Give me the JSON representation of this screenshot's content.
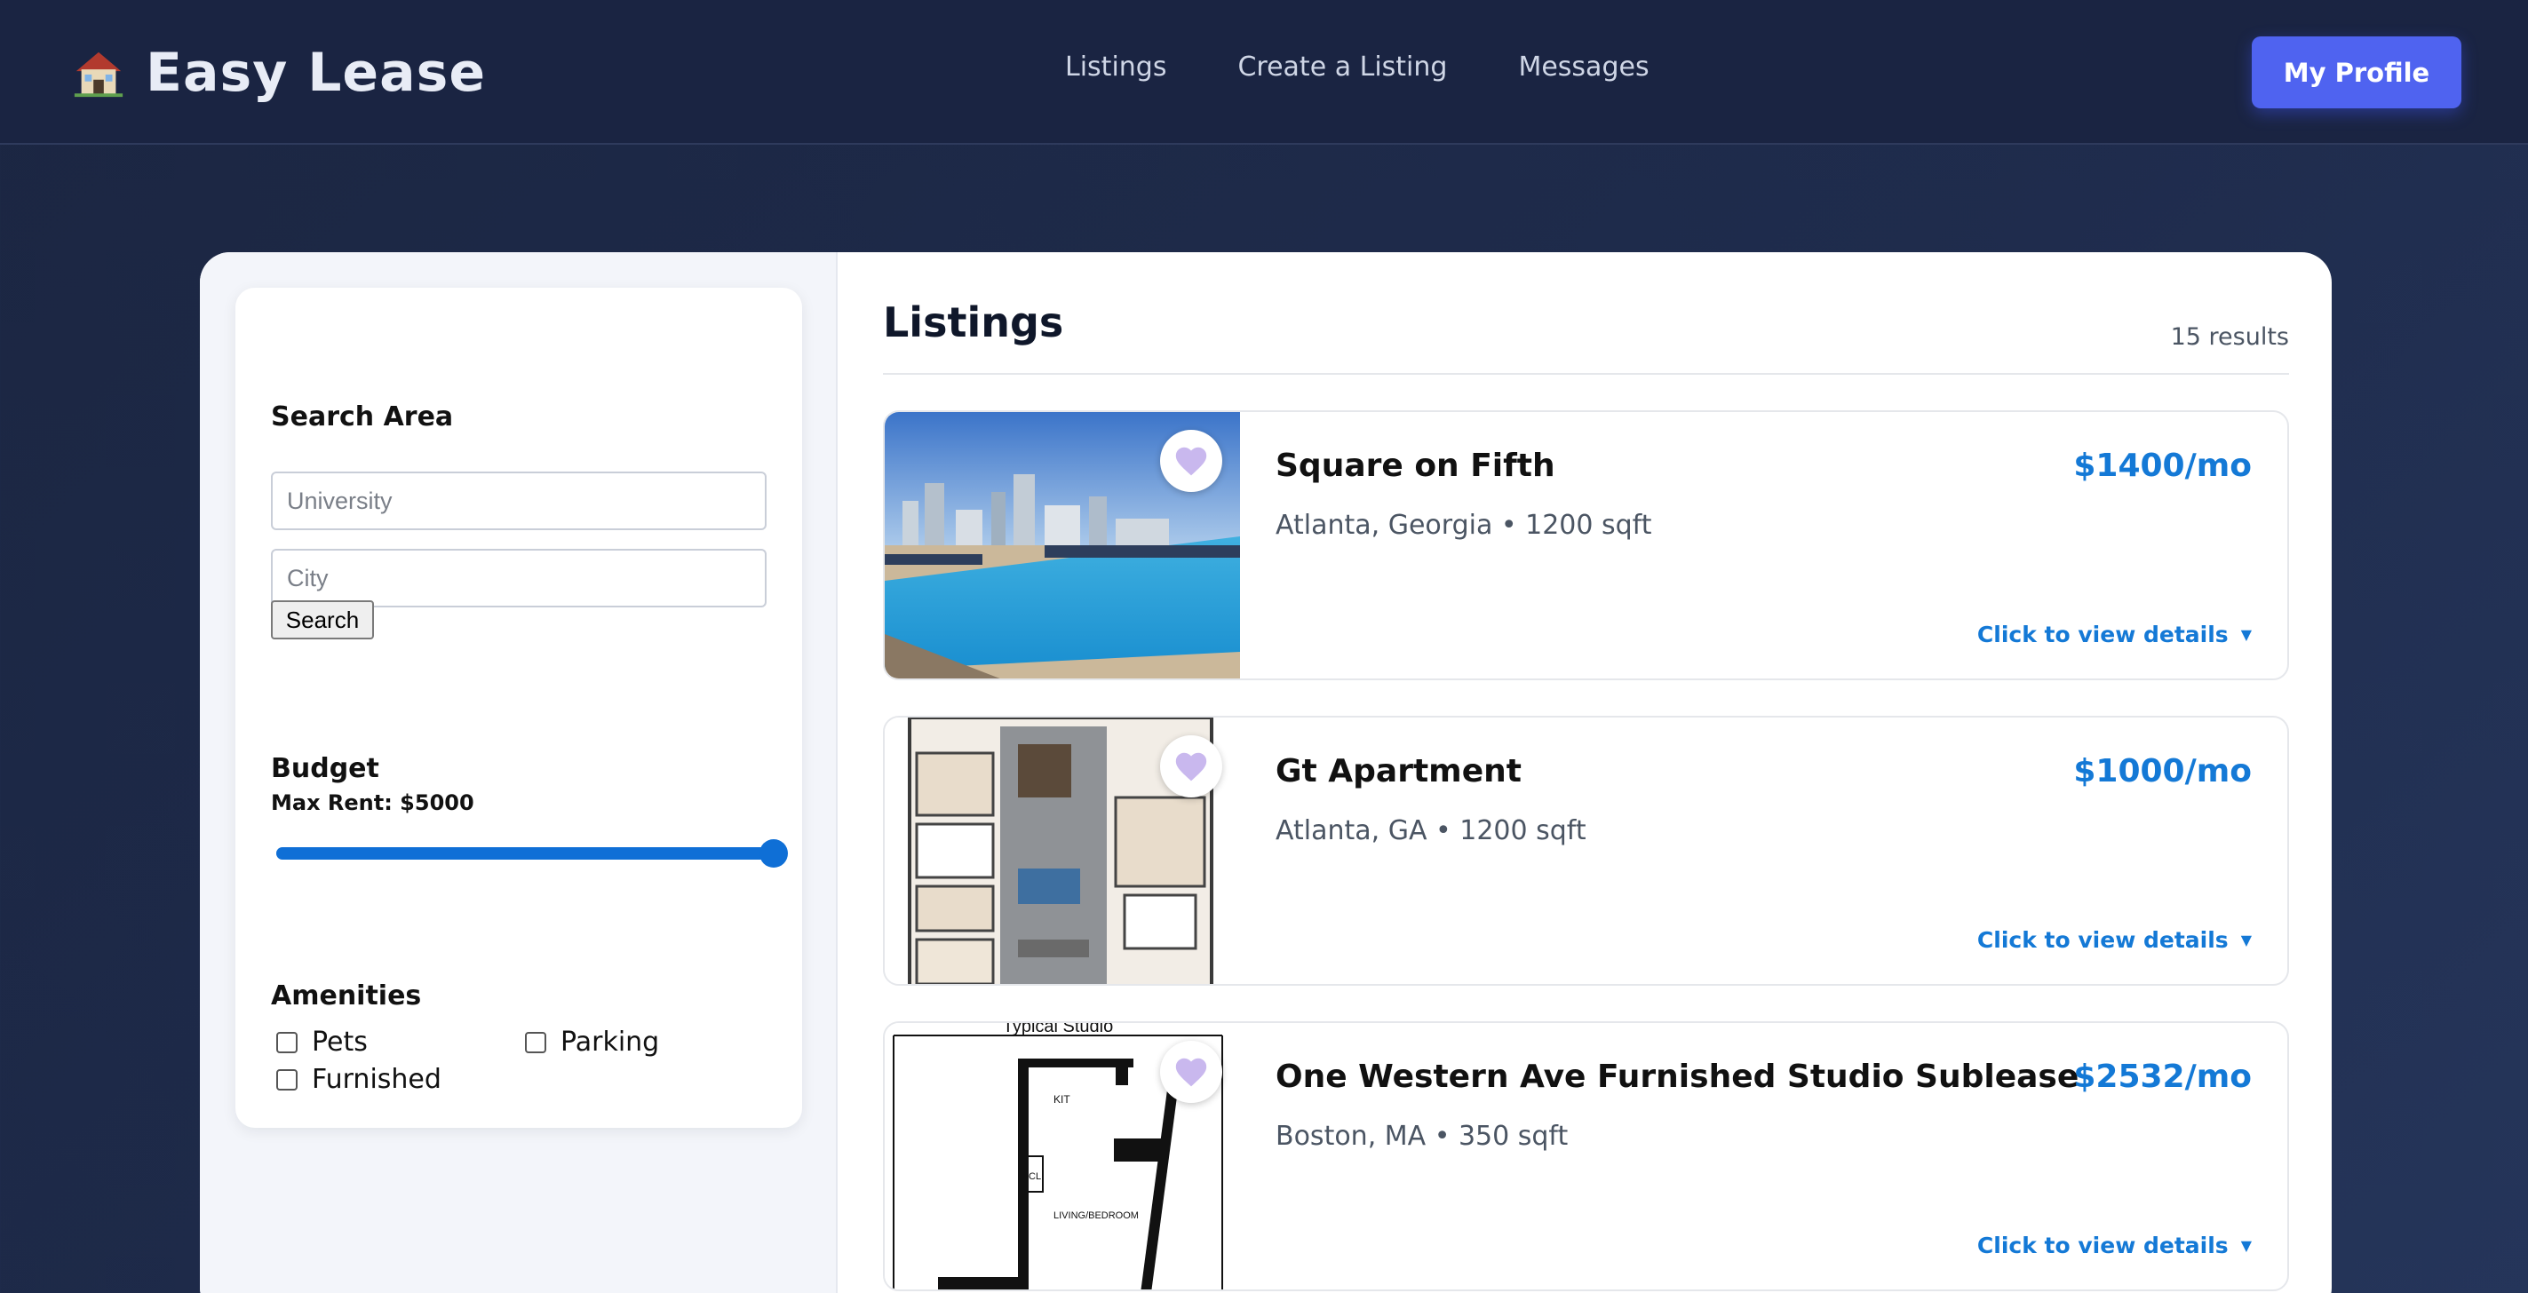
{
  "header": {
    "brand_name": "Easy Lease",
    "brand_icon": "house-emoji-icon",
    "nav": [
      "Listings",
      "Create a Listing",
      "Messages"
    ],
    "profile_button": "My Profile"
  },
  "filters": {
    "search_area_title": "Search Area",
    "university_placeholder": "University",
    "city_placeholder": "City",
    "search_button": "Search",
    "budget_title": "Budget",
    "max_rent_label": "Max Rent: $5000",
    "max_rent_fraction": 1.0,
    "amenities_title": "Amenities",
    "amenities": [
      {
        "label": "Pets",
        "checked": false
      },
      {
        "label": "Parking",
        "checked": false
      },
      {
        "label": "Furnished",
        "checked": false
      }
    ]
  },
  "listings": {
    "title": "Listings",
    "result_count": "15 results",
    "details_label": "Click to view details",
    "items": [
      {
        "title": "Square on Fifth",
        "price": "$1400/mo",
        "meta": "Atlanta, Georgia • 1200 sqft",
        "image": "rooftop-pool-photo"
      },
      {
        "title": "Gt Apartment",
        "price": "$1000/mo",
        "meta": "Atlanta, GA • 1200 sqft",
        "image": "floor-plan-3d-photo"
      },
      {
        "title": "One Western Ave Furnished Studio Sublease",
        "price": "$2532/mo",
        "meta": "Boston, MA • 350 sqft",
        "image": "studio-floor-plan-drawing",
        "image_caption": "Typical Studio",
        "plan_labels": [
          "KIT",
          "CL",
          "LIVING/BEDROOM"
        ]
      }
    ]
  },
  "colors": {
    "header_bg": "#1a2442",
    "accent_button": "#4f63f0",
    "price_blue": "#1479d6",
    "slider_blue": "#0f6fd6"
  }
}
